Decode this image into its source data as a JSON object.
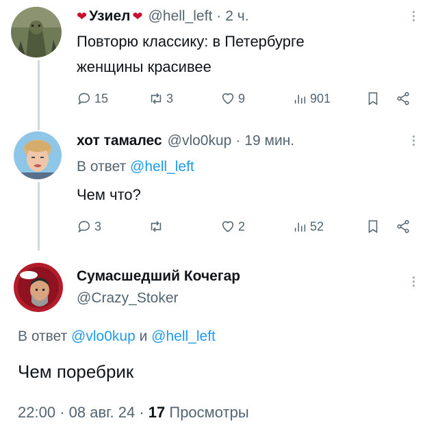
{
  "tweet1": {
    "author_name": "Узиел",
    "handle": "@hell_left",
    "dot": "·",
    "time": "2 ч.",
    "text_line1": "Повторю классику: в Петербурге",
    "text_line2": "женщины красивее",
    "replies": "15",
    "retweets": "3",
    "likes": "9",
    "views": "901"
  },
  "tweet2": {
    "author_name": "хот тамалес",
    "handle": "@vlo0kup",
    "dot": "·",
    "time": "19 мин.",
    "reply_prefix": "В ответ",
    "reply_handle": "@hell_left",
    "text": "Чем что?",
    "replies": "3",
    "likes": "2",
    "views": "52"
  },
  "tweet3": {
    "author_name": "Сумасшедший Кочегар",
    "handle": "@Crazy_Stoker",
    "reply_prefix": "В ответ",
    "reply_handle1": "@vlo0kup",
    "reply_and": "и",
    "reply_handle2": "@hell_left",
    "text": "Чем поребрик",
    "time": "22:00",
    "sep1": "·",
    "date": "08 авг. 24",
    "sep2": "·",
    "views_count": "17",
    "views_label": "Просмотры"
  },
  "colors": {
    "accent": "#1d9bf0",
    "secondary_text": "#536471",
    "primary_text": "#0f1419",
    "thread_line": "#cfd9de"
  }
}
